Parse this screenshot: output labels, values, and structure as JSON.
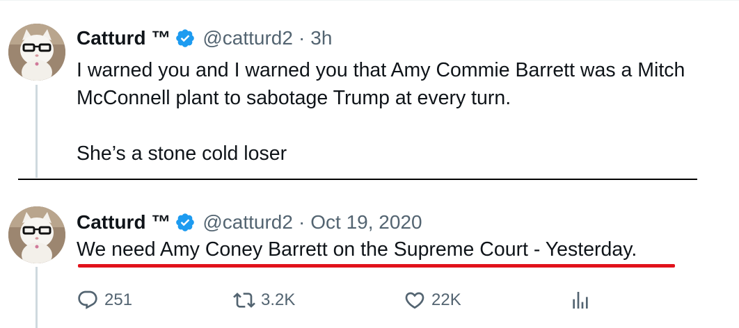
{
  "tweets": [
    {
      "author_name": "Catturd ™",
      "handle": "@catturd2",
      "separator": "·",
      "time": "3h",
      "paragraphs": [
        "I warned you and I warned you that Amy Commie Barrett was a Mitch McConnell plant to sabotage Trump at every turn.",
        "She’s a stone cold loser"
      ]
    },
    {
      "author_name": "Catturd ™",
      "handle": "@catturd2",
      "separator": "·",
      "time": "Oct 19, 2020",
      "text": "We need Amy Coney Barrett on the Supreme Court - Yesterday.",
      "stats": {
        "replies": "251",
        "retweets": "3.2K",
        "likes": "22K"
      }
    }
  ],
  "icons": {
    "verified": "verified-badge-icon",
    "reply": "reply-bubble-icon",
    "retweet": "retweet-icon",
    "like": "heart-icon",
    "views": "views-bar-chart-icon"
  },
  "colors": {
    "text_primary": "#0f1419",
    "text_secondary": "#536471",
    "verified_blue": "#1d9bf0",
    "annotation_red": "#e1121b",
    "thread_line": "#cfd9de"
  }
}
